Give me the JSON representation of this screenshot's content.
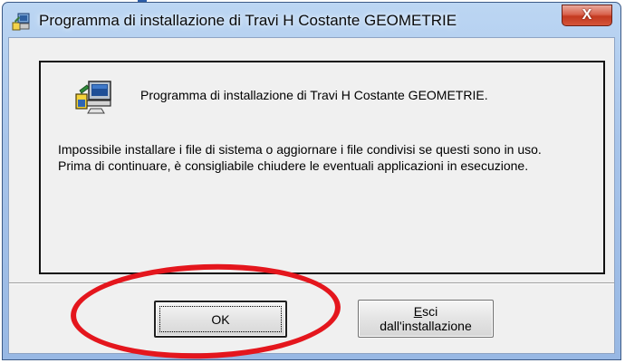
{
  "window": {
    "title": "Programma di installazione di Travi H Costante GEOMETRIE",
    "close_label": "X"
  },
  "message": {
    "heading": "Programma di installazione di Travi H Costante GEOMETRIE.",
    "body": "Impossibile installare i file di sistema o aggiornare i file condivisi se questi sono in uso. Prima di continuare, è consigliabile chiudere le eventuali applicazioni in esecuzione."
  },
  "buttons": {
    "ok_label": "OK",
    "exit_label_line1": "Esci",
    "exit_label_line2": "dall'installazione"
  },
  "icons": {
    "app": "setup-computer-icon",
    "setup": "setup-computer-icon",
    "close": "close-icon"
  },
  "colors": {
    "highlight_ring": "#e4161d",
    "titlebar": "#a7c4ea"
  }
}
